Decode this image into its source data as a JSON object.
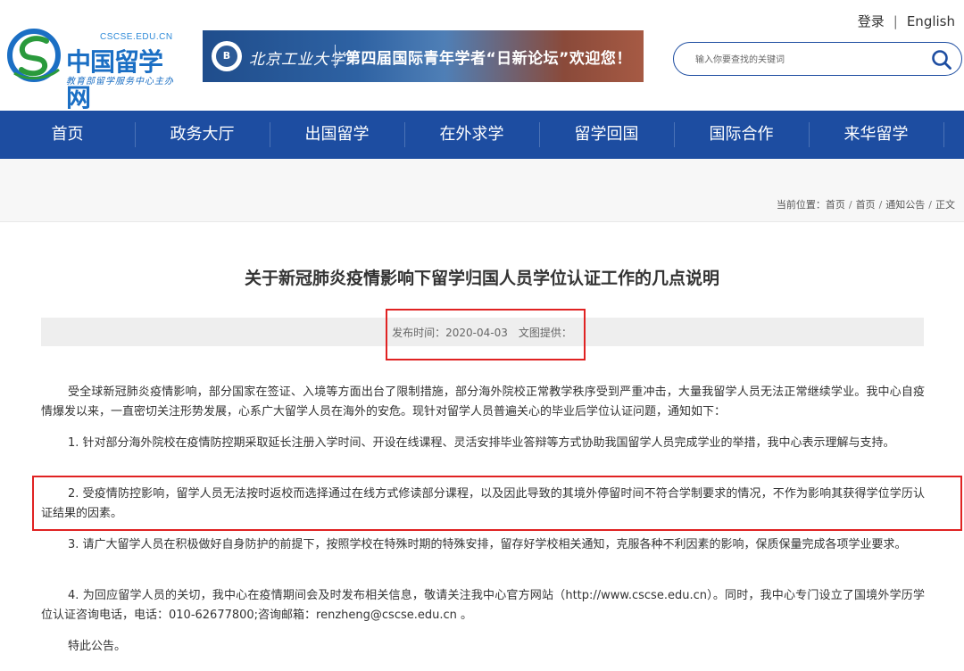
{
  "header": {
    "logo_en": "CSCSE.EDU.CN",
    "logo_cn": "中国留学网",
    "logo_sub": "教育部留学服务中心主办",
    "login": "登录",
    "english": "English",
    "search_placeholder": "输入你要查找的关键词"
  },
  "banner": {
    "school": "北京工业大学",
    "text": "第四届国际青年学者“日新论坛”欢迎您！"
  },
  "nav": {
    "items": [
      "首页",
      "政务大厅",
      "出国留学",
      "在外求学",
      "留学回国",
      "国际合作",
      "来华留学"
    ]
  },
  "breadcrumb": {
    "prefix": "当前位置：",
    "items": [
      "首页",
      "首页",
      "通知公告",
      "正文"
    ]
  },
  "article": {
    "title": "关于新冠肺炎疫情影响下留学归国人员学位认证工作的几点说明",
    "publish_label": "发布时间：",
    "publish_date": "2020-04-03",
    "provider_label": "文图提供：",
    "paragraphs": [
      "受全球新冠肺炎疫情影响，部分国家在签证、入境等方面出台了限制措施，部分海外院校正常教学秩序受到严重冲击，大量我留学人员无法正常继续学业。我中心自疫情爆发以来，一直密切关注形势发展，心系广大留学人员在海外的安危。现针对留学人员普遍关心的毕业后学位认证问题，通知如下：",
      "1. 针对部分海外院校在疫情防控期采取延长注册入学时间、开设在线课程、灵活安排毕业答辩等方式协助我国留学人员完成学业的举措，我中心表示理解与支持。",
      "2. 受疫情防控影响，留学人员无法按时返校而选择通过在线方式修读部分课程，以及因此导致的其境外停留时间不符合学制要求的情况，不作为影响其获得学位学历认证结果的因素。",
      "3. 请广大留学人员在积极做好自身防护的前提下，按照学校在特殊时期的特殊安排，留存好学校相关通知，克服各种不利因素的影响，保质保量完成各项学业要求。",
      "4. 为回应留学人员的关切，我中心在疫情期间会及时发布相关信息，敬请关注我中心官方网站（http://www.cscse.edu.cn）。同时，我中心专门设立了国境外学历学位认证咨询电话，电话：010-62677800;咨询邮箱：renzheng@cscse.edu.cn 。",
      "特此公告。"
    ]
  },
  "colors": {
    "nav_bg": "#1d4da1",
    "highlight_border": "#e02222",
    "meta_bg": "#eeeeee"
  }
}
